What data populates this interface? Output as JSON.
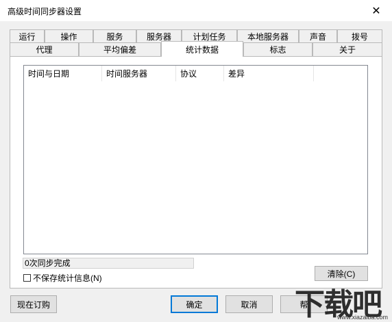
{
  "window": {
    "title": "高级时间同步器设置",
    "close_glyph": "✕"
  },
  "tabs": {
    "row1": [
      "运行",
      "操作",
      "服务",
      "服务器",
      "计划任务",
      "本地服务器",
      "声音",
      "拨号"
    ],
    "row2": [
      "代理",
      "平均偏差",
      "统计数据",
      "标志",
      "关于"
    ],
    "active": "统计数据"
  },
  "listview": {
    "columns": [
      "时间与日期",
      "时间服务器",
      "协议",
      "差异"
    ]
  },
  "status": {
    "text": "0次同步完成"
  },
  "checkbox": {
    "label": "不保存统计信息(N)",
    "checked": false
  },
  "buttons": {
    "clear": "清除(C)",
    "subscribe": "现在订购",
    "ok": "确定",
    "cancel": "取消",
    "help": "帮"
  },
  "watermark": {
    "logo": "下载吧",
    "url": "www.xiazaiba.com"
  }
}
